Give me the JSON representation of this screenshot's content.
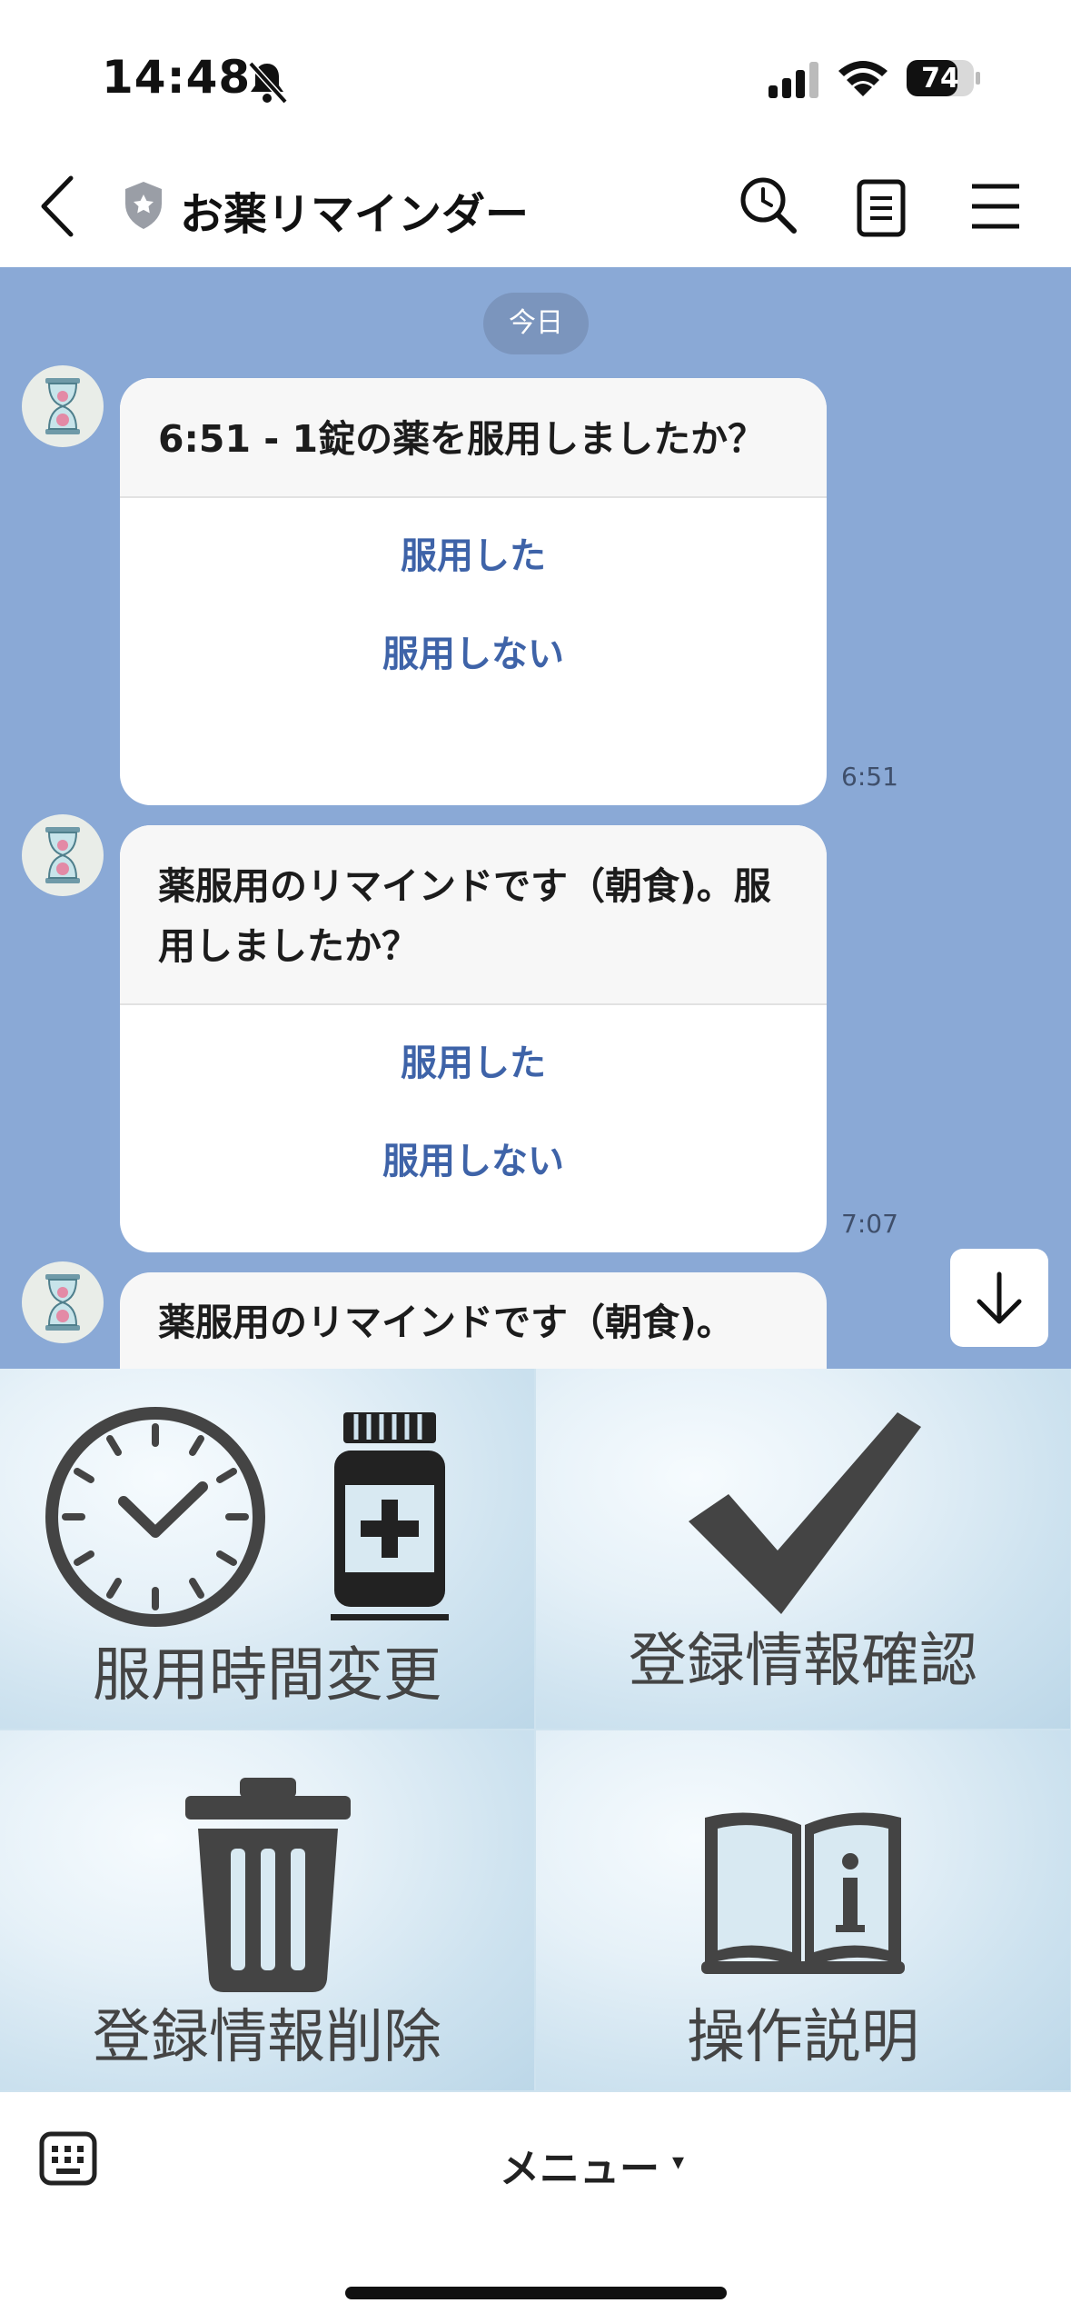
{
  "status_bar": {
    "time": "14:48",
    "battery": "74"
  },
  "header": {
    "title": "お薬リマインダー"
  },
  "chat": {
    "date_label": "今日",
    "messages": [
      {
        "question": "6:51 - 1錠の薬を服用しましたか？",
        "buttons": [
          "服用した",
          "服用しない"
        ],
        "time": "6:51"
      },
      {
        "question": "薬服用のリマインドです（朝食)。服用しましたか？",
        "buttons": [
          "服用した",
          "服用しない"
        ],
        "time": "7:07"
      },
      {
        "question": "薬服用のリマインドです（朝食)。"
      }
    ]
  },
  "rich_menu": {
    "items": [
      {
        "label": "服用時間変更",
        "icons": [
          "clock-icon",
          "medicine-bottle-icon"
        ]
      },
      {
        "label": "登録情報確認",
        "icons": [
          "checkmark-icon"
        ]
      },
      {
        "label": "登録情報削除",
        "icons": [
          "trash-icon"
        ]
      },
      {
        "label": "操作説明",
        "icons": [
          "info-book-icon"
        ]
      }
    ]
  },
  "bottom_bar": {
    "menu_label": "メニュー",
    "caret": "▾"
  },
  "colors": {
    "chat_bg": "#8aa9d6",
    "button_text": "#3e63a8"
  }
}
